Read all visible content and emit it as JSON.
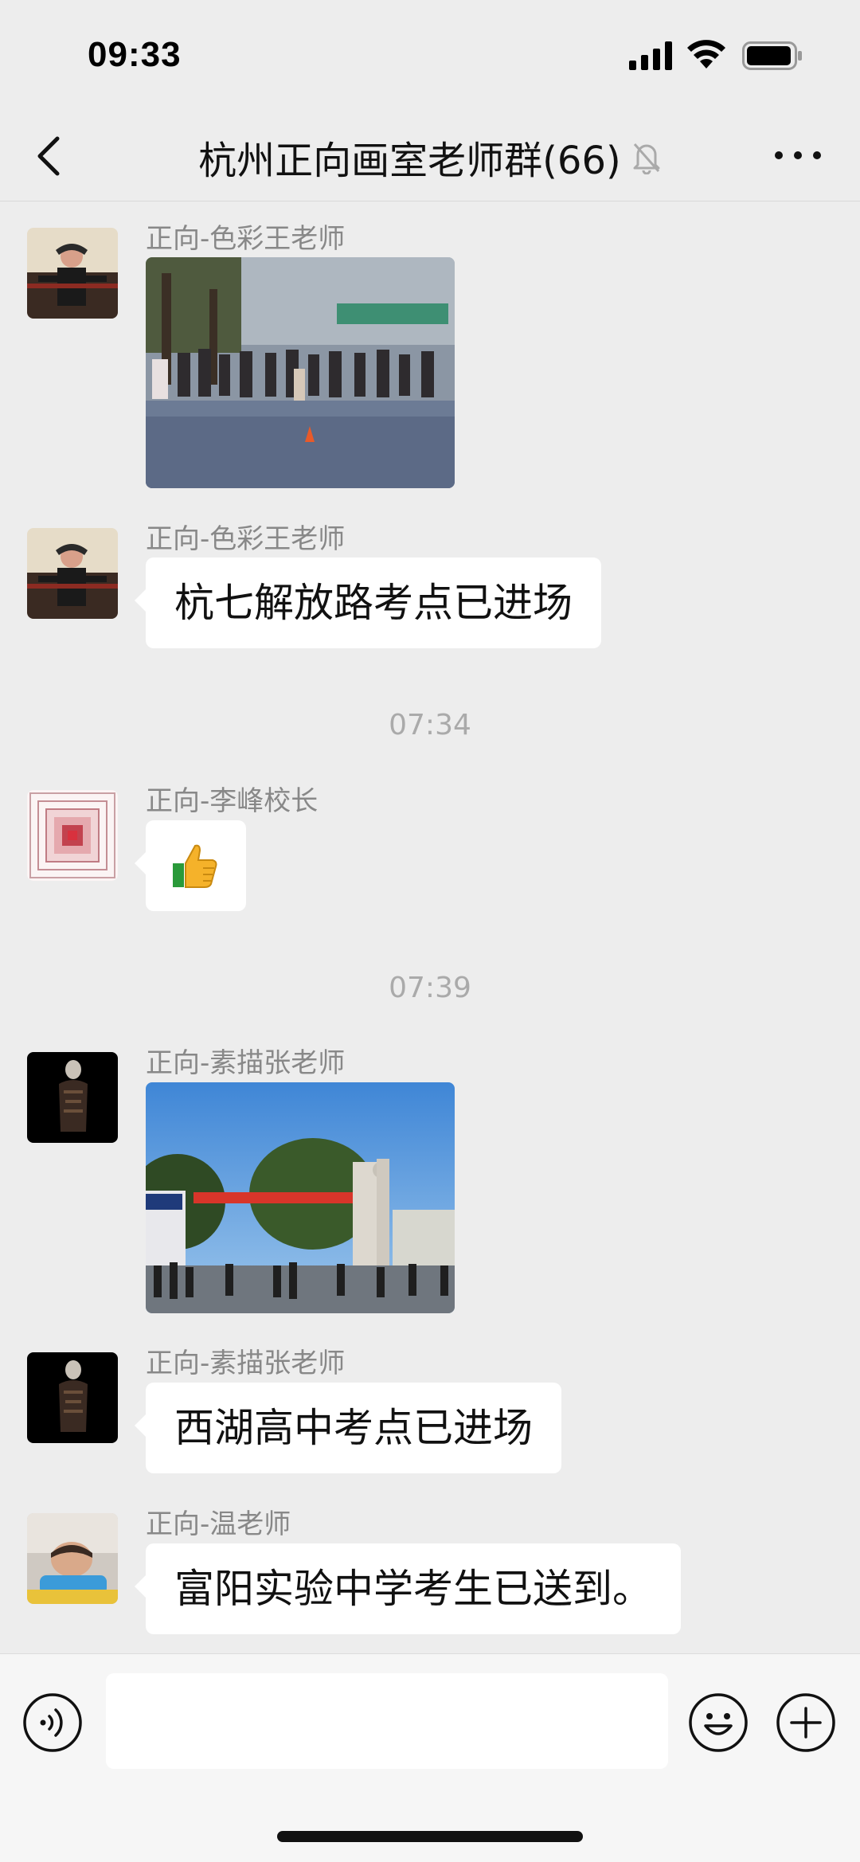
{
  "status_bar": {
    "time": "09:33",
    "icons": [
      "cellular-signal-icon",
      "wifi-icon",
      "battery-icon"
    ]
  },
  "nav": {
    "back_icon": "chevron-left-icon",
    "title": "杭州正向画室老师群(66)",
    "mute_icon": "bell-off-icon",
    "more_icon": "more-dots-icon"
  },
  "messages": [
    {
      "sender": "正向-色彩王老师",
      "type": "image",
      "image_desc": "photo"
    },
    {
      "sender": "正向-色彩王老师",
      "type": "text",
      "text": "杭七解放路考点已进场"
    },
    {
      "type": "time",
      "text": "07:34"
    },
    {
      "sender": "正向-李峰校长",
      "type": "emoji",
      "emoji": "thumbs-up-icon"
    },
    {
      "type": "time",
      "text": "07:39"
    },
    {
      "sender": "正向-素描张老师",
      "type": "image",
      "image_desc": "photo"
    },
    {
      "sender": "正向-素描张老师",
      "type": "text",
      "text": "西湖高中考点已进场"
    },
    {
      "sender": "正向-温老师",
      "type": "text",
      "text": "富阳实验中学考生已送到。"
    }
  ],
  "input_bar": {
    "voice_icon": "voice-icon",
    "text_value": "",
    "emoji_icon": "smiley-icon",
    "plus_icon": "plus-circle-icon"
  },
  "colors": {
    "background": "#ededed",
    "bubble": "#ffffff",
    "sender_text": "#888888",
    "time_text": "#aaaaaa"
  }
}
